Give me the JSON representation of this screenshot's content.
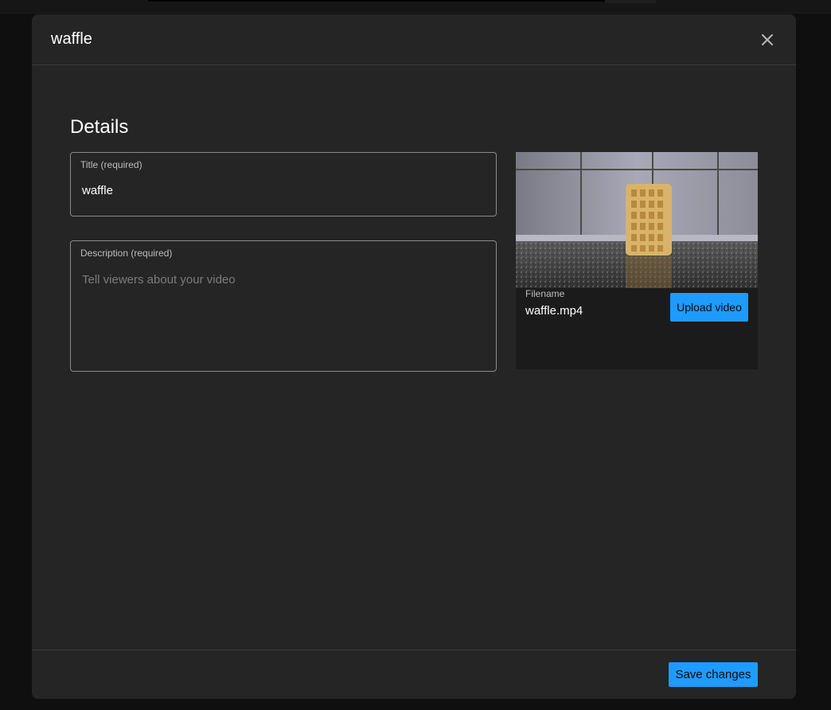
{
  "dialog": {
    "title": "waffle"
  },
  "details": {
    "heading": "Details",
    "title_field": {
      "label": "Title (required)",
      "value": "waffle"
    },
    "description_field": {
      "label": "Description (required)",
      "value": "",
      "placeholder": "Tell viewers about your video"
    }
  },
  "video": {
    "thumbnail": "waffle-video-thumbnail",
    "filename_label": "Filename",
    "filename": "waffle.mp4",
    "upload_label": "Upload video"
  },
  "footer": {
    "save_label": "Save changes"
  },
  "icons": {
    "close": "close-icon"
  },
  "colors": {
    "accent": "#1e9bff",
    "dialog_bg": "#252525",
    "page_bg": "#0f0f0f"
  }
}
